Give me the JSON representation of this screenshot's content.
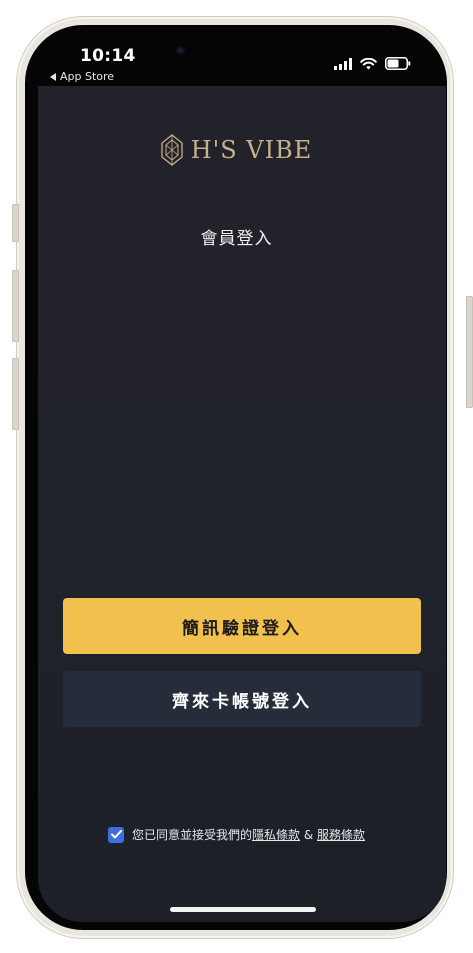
{
  "status_bar": {
    "time": "10:14",
    "back_label": "App Store"
  },
  "logo": {
    "text": "H'S VIBE",
    "emblem_icon": "diamond-emblem-icon",
    "color": "#c8b089"
  },
  "page": {
    "title": "會員登入"
  },
  "buttons": {
    "sms_login": "簡訊驗證登入",
    "card_login": "齊來卡帳號登入"
  },
  "agreement": {
    "checked": true,
    "prefix": "您已同意並接受我們的",
    "privacy_link": "隱私條款",
    "ampersand": "&",
    "terms_link": "服務條款"
  },
  "colors": {
    "primary_button": "#f2c14d",
    "secondary_button": "#252d3a",
    "checkbox": "#3f6ee0",
    "background": "#20222b"
  }
}
